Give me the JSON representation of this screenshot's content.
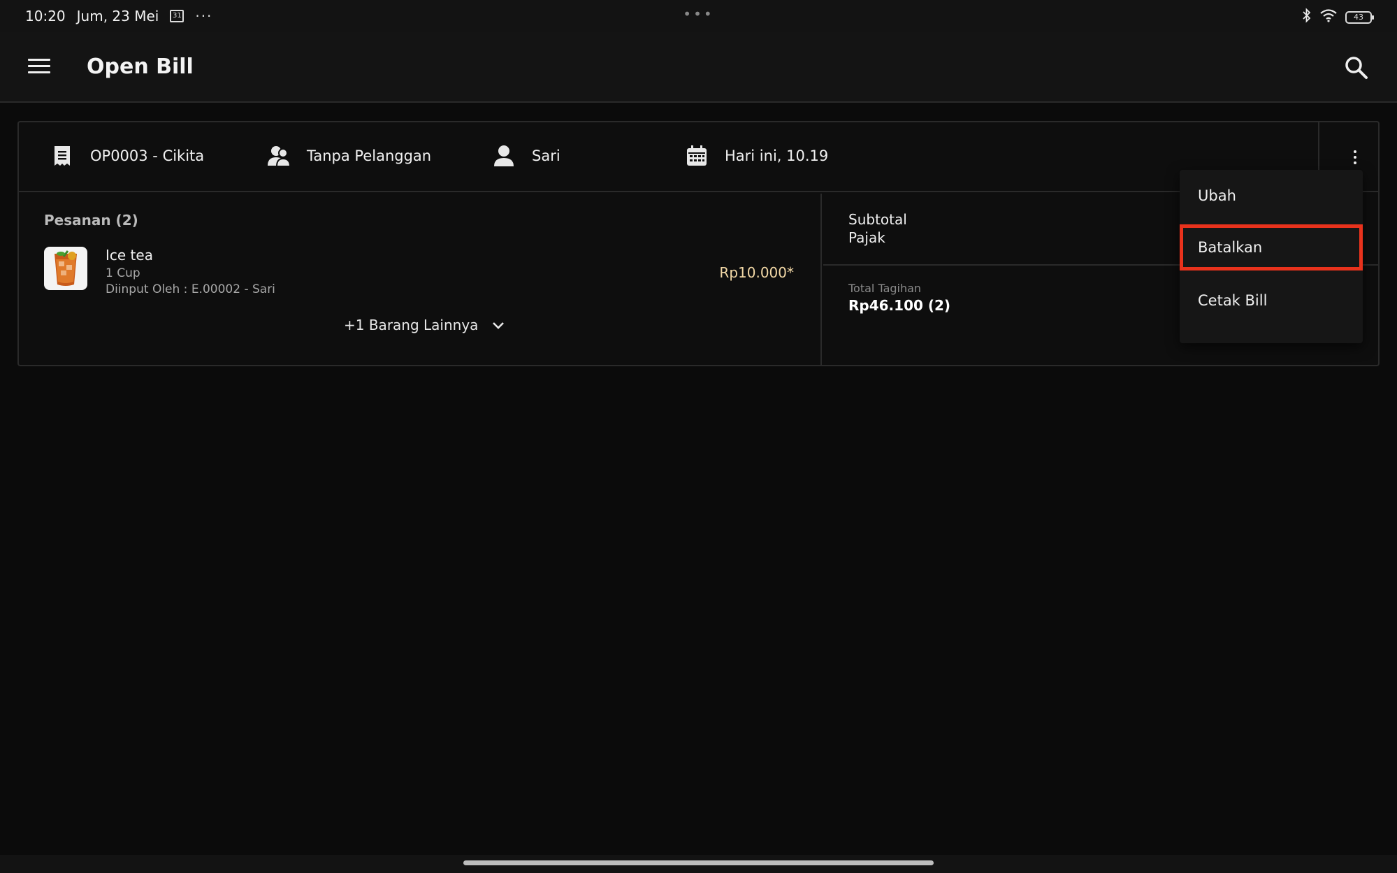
{
  "status_bar": {
    "time": "10:20",
    "date": "Jum, 23 Mei",
    "calendar_day": "31",
    "more_glyph": "···",
    "center_glyph": "•••",
    "battery": "43",
    "icons": [
      "calendar-icon",
      "bluetooth-icon",
      "wifi-icon",
      "battery-icon"
    ]
  },
  "app_bar": {
    "title": "Open Bill",
    "icons": [
      "menu-icon",
      "search-icon"
    ]
  },
  "bill": {
    "bill_id": "OP0003 - Cikita",
    "customer": "Tanpa Pelanggan",
    "staff": "Sari",
    "datetime": "Hari ini, 10.19",
    "header_icons": [
      "receipt-icon",
      "users-icon",
      "user-icon",
      "calendar-icon",
      "more-vertical-icon"
    ],
    "orders": {
      "title": "Pesanan (2)",
      "items": [
        {
          "name": "Ice tea",
          "qty": "1 Cup",
          "entered_by": "Diinput Oleh : E.00002 - Sari",
          "price": "Rp10.000*",
          "icon": "ice-tea-image"
        }
      ],
      "more_label": "+1 Barang Lainnya"
    },
    "summary": {
      "subtotal_label": "Subtotal",
      "tax_label": "Pajak",
      "total_label": "Total Tagihan",
      "total_value": "Rp46.100 (2)"
    }
  },
  "dropdown_menu": {
    "items": [
      {
        "label": "Ubah"
      },
      {
        "label": "Batalkan",
        "highlighted": true
      },
      {
        "label": "Cetak Bill"
      }
    ],
    "highlight_color": "#e8321c"
  },
  "colors": {
    "background": "#0b0b0b",
    "surface": "#141414",
    "price_accent": "#f2d8a6"
  }
}
